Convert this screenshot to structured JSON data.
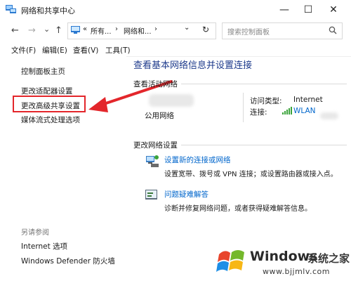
{
  "window": {
    "title": "网络和共享中心",
    "minimize_glyph": "—",
    "maximize_glyph": "☐",
    "close_glyph": "✕"
  },
  "address": {
    "back": "←",
    "forward": "→",
    "recent": "⌄",
    "up": "↑",
    "crumb_sep": "«",
    "crumb1": "所有...",
    "crumb2": "网络和...",
    "crumb_arrow1": "›",
    "crumb_arrow2": "›",
    "dropdown": "⌄",
    "refresh": "↻",
    "search_placeholder": "搜索控制面板",
    "search_icon": "search-icon"
  },
  "menu": [
    "文件(F)",
    "编辑(E)",
    "查看(V)",
    "工具(T)"
  ],
  "sidebar": {
    "home": "控制面板主页",
    "adapter": "更改适配器设置",
    "advanced_sharing": "更改高级共享设置",
    "media_streaming": "媒体流式处理选项",
    "see_also": "另请参阅",
    "internet_options": "Internet 选项",
    "defender": "Windows Defender 防火墙"
  },
  "main": {
    "title": "查看基本网络信息并设置连接",
    "active_networks": "查看活动网络",
    "network_type": "公用网络",
    "access_type_label": "访问类型:",
    "access_type_value": "Internet",
    "connection_label": "连接:",
    "connection_value": "WLAN",
    "change_settings": "更改网络设置",
    "setup_link": "设置新的连接或网络",
    "setup_desc": "设置宽带、拨号或 VPN 连接；或设置路由器或接入点。",
    "troubleshoot_link": "问题疑难解答",
    "troubleshoot_desc": "诊断并修复网络问题，或者获得疑难解答信息。"
  },
  "watermark": {
    "brand": "Windows",
    "cn": "系统之家",
    "url": "www.bjjmlv.com"
  },
  "colors": {
    "annotation_red": "#e3262b",
    "title_blue": "#1e3b8c",
    "link_blue": "#0066cc"
  }
}
